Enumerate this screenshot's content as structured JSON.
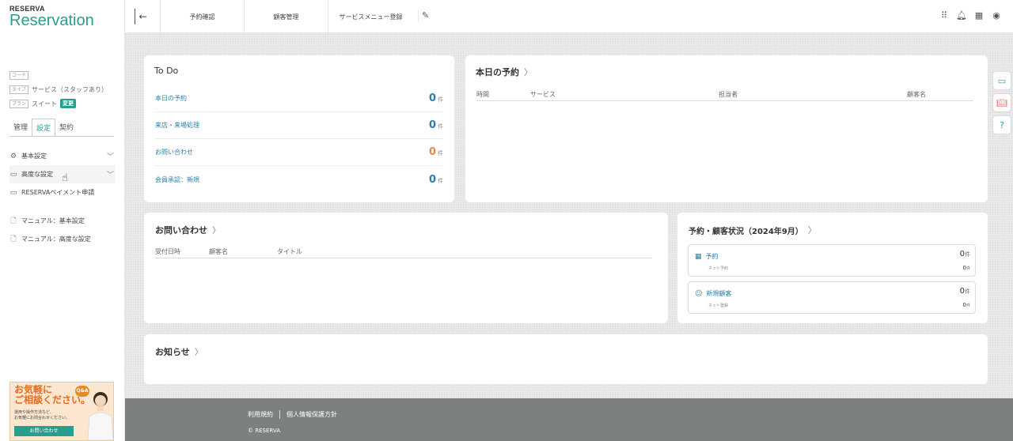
{
  "brand": {
    "small": "RESERVA",
    "big": "Reservation"
  },
  "account": {
    "code_tag": "コード",
    "type_tag": "タイプ",
    "type_value": "サービス（スタッフあり）",
    "plan_tag": "プラン",
    "plan_value": "スイート",
    "change_badge": "変更"
  },
  "sidebar_tabs": [
    "管理",
    "設定",
    "契約"
  ],
  "sidebar_menu": [
    {
      "label": "基本設定",
      "icon": "gear-icon"
    },
    {
      "label": "高度な設定",
      "icon": "keyboard-icon"
    },
    {
      "label": "RESERVAペイメント申請",
      "icon": "card-icon"
    }
  ],
  "sidebar_manuals": [
    {
      "label": "マニュアル：基本設定",
      "icon": "document-icon"
    },
    {
      "label": "マニュアル：高度な設定",
      "icon": "document-icon"
    }
  ],
  "banner": {
    "line1": "お気軽に",
    "line2": "ご相談ください。",
    "desc1": "運用や操作方法など、",
    "desc2": "お気軽にお問合わせください。",
    "qa": "Q&A",
    "button": "お問い合わせ"
  },
  "topnav": [
    "予約確認",
    "顧客管理",
    "サービスメニュー登録"
  ],
  "todo": {
    "title": "To Do",
    "unit": "件",
    "items": [
      {
        "label": "本日の予約",
        "value": "0",
        "color": "#2a7fa8"
      },
      {
        "label": "来店・来場処理",
        "value": "0",
        "color": "#2a7fa8"
      },
      {
        "label": "お問い合わせ",
        "value": "0",
        "color": "#e58a4a"
      },
      {
        "label": "会員承認：新規",
        "value": "0",
        "color": "#2a7fa8"
      }
    ]
  },
  "today": {
    "title": "本日の予約",
    "columns": [
      "時間",
      "サービス",
      "担当者",
      "顧客名"
    ]
  },
  "inquiries": {
    "title": "お問い合わせ",
    "columns": [
      "受付日時",
      "顧客名",
      "タイトル"
    ]
  },
  "status": {
    "title": "予約・顧客状況（2024年9月）",
    "boxes": [
      {
        "label": "予約",
        "icon": "calendar-icon",
        "value": "0",
        "unit": "件",
        "sub_label": "ネット予約",
        "sub_value": "0",
        "sub_unit": "件"
      },
      {
        "label": "新規顧客",
        "icon": "users-icon",
        "value": "0",
        "unit": "件",
        "sub_label": "ネット登録",
        "sub_value": "0",
        "sub_unit": "件"
      }
    ]
  },
  "news": {
    "title": "お知らせ"
  },
  "footer": {
    "links": [
      "利用規約",
      "個人情報保護方針"
    ],
    "copyright": "© RESERVA"
  },
  "colors": {
    "accent": "#2a9e8e",
    "link": "#2a7fa8",
    "warn": "#e58a4a"
  }
}
